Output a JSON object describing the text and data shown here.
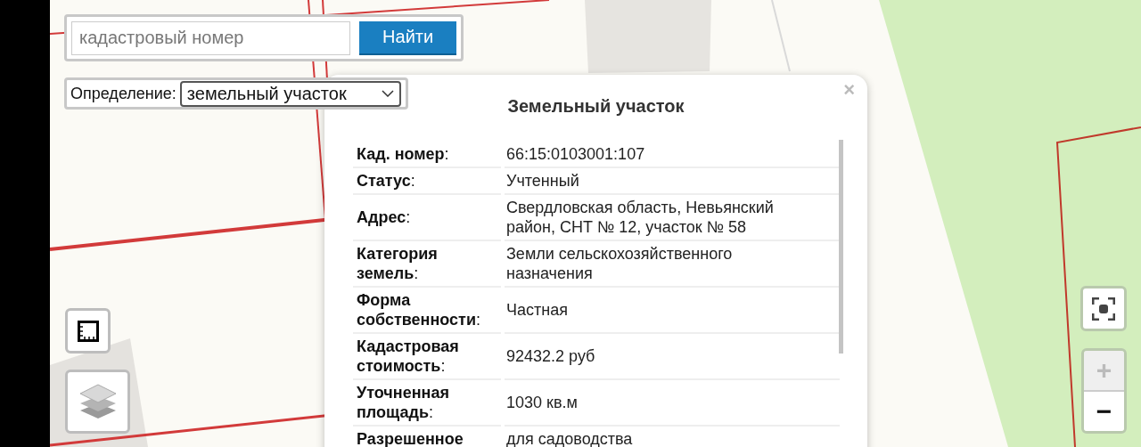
{
  "search": {
    "placeholder": "кадастровый номер",
    "button": "Найти"
  },
  "definition": {
    "label": "Определение:",
    "value": "земельный участок"
  },
  "popup": {
    "title": "Земельный участок",
    "close": "×",
    "rows": [
      {
        "label": "**Кад. номер**:",
        "value": "66:15:0103001:107"
      },
      {
        "label": "**Статус**:",
        "value": "Учтенный"
      },
      {
        "label": "**Адрес**:",
        "value": "Свердловская область, Невьянский район, СНТ № 12, участок № 58"
      },
      {
        "label": "**Категория земель**:",
        "value": "Земли сельскохозяйственного назначения"
      },
      {
        "label": "**Форма собственности**:",
        "value": "Частная"
      },
      {
        "label": "**Кадастровая стоимость**:",
        "value": "92432.2 руб"
      },
      {
        "label": "**Уточненная площадь**:",
        "value": "1030 кв.м"
      },
      {
        "label": "**Разрешенное**",
        "value": "для садоводства"
      }
    ]
  },
  "zoom": [
    {
      "label": "+",
      "disabled": true
    },
    {
      "label": "−",
      "disabled": false
    }
  ]
}
